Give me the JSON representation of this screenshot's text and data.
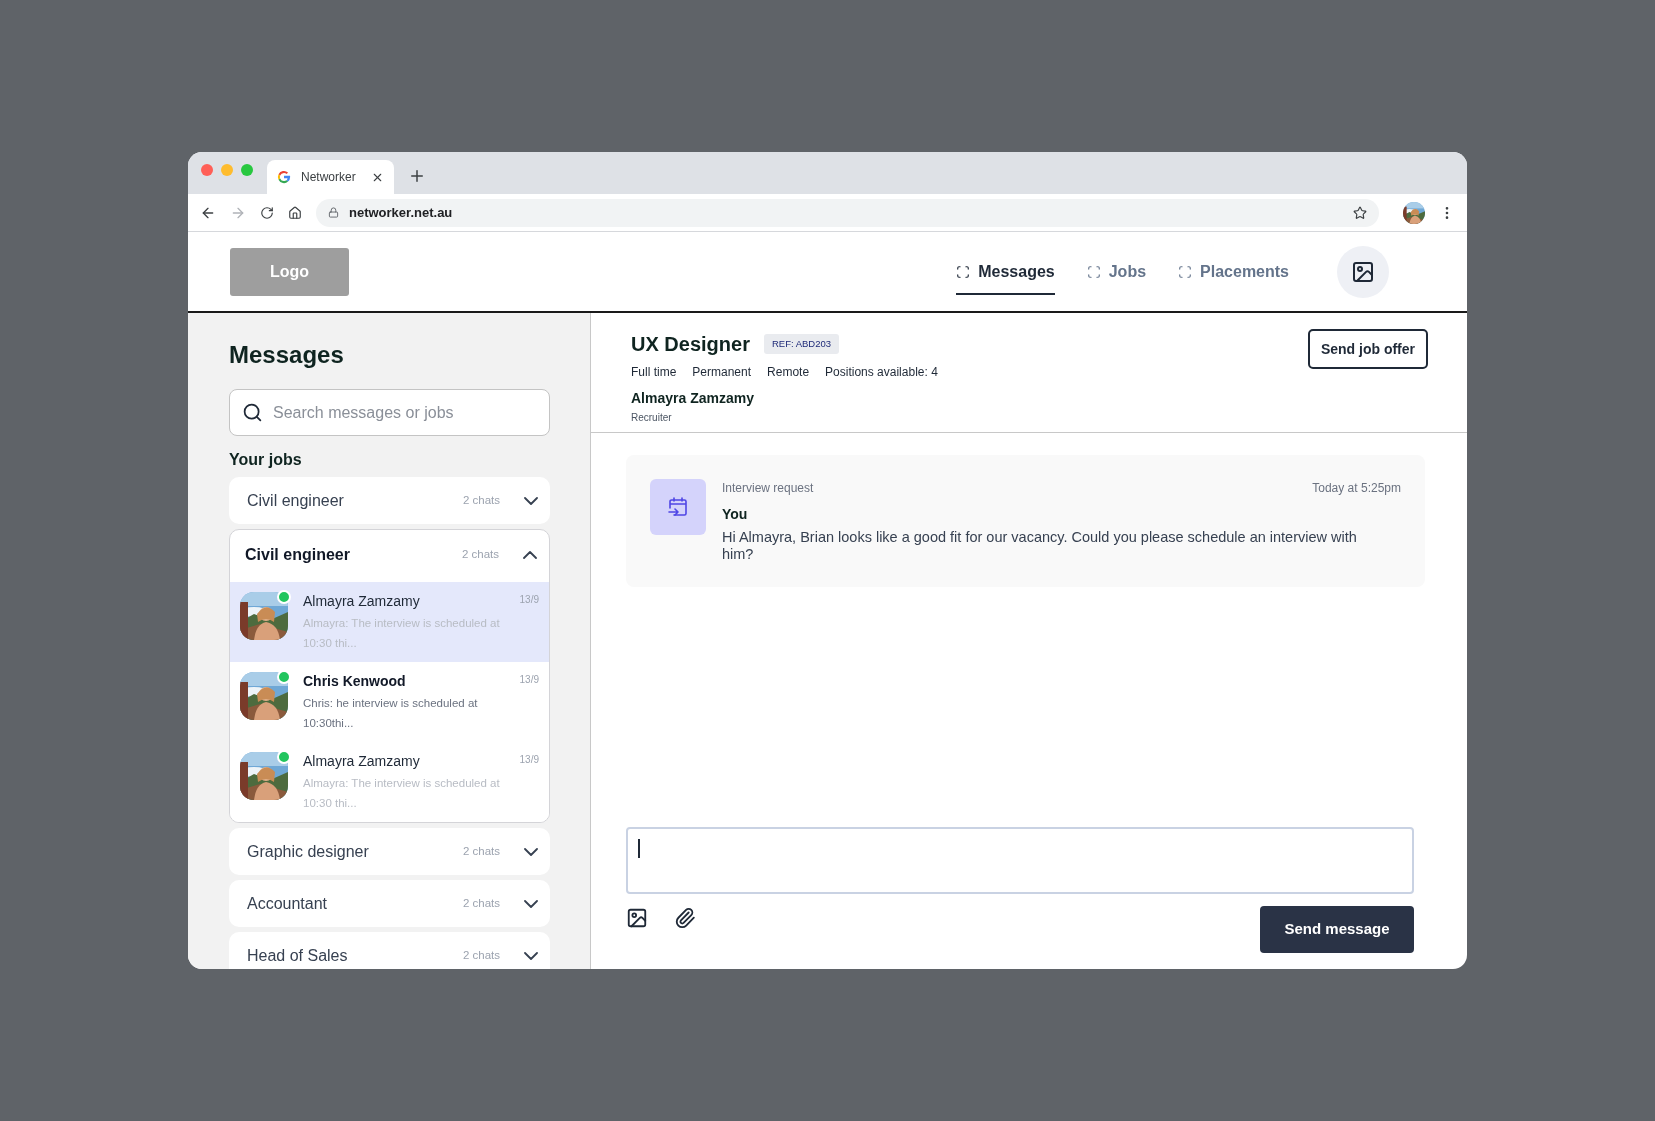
{
  "browser": {
    "tab_title": "Networker",
    "url": "networker.net.au"
  },
  "header": {
    "logo": "Logo",
    "nav": [
      {
        "label": "Messages",
        "selected": true
      },
      {
        "label": "Jobs",
        "selected": false
      },
      {
        "label": "Placements",
        "selected": false
      }
    ]
  },
  "sidebar": {
    "title": "Messages",
    "search": {
      "placeholder": "Search messages or jobs"
    },
    "section_label": "Your jobs",
    "jobs": [
      {
        "title": "Civil engineer",
        "chats": "2 chats",
        "expanded": false
      },
      {
        "title": "Civil engineer",
        "chats": "2 chats",
        "expanded": true,
        "conversations": [
          {
            "name": "Almayra Zamzamy",
            "time": "13/9",
            "preview": "Almayra: The interview is scheduled at 10:30 thi...",
            "unread": false,
            "selected": true,
            "online": true
          },
          {
            "name": "Chris Kenwood",
            "time": "13/9",
            "preview": "Chris: he interview is scheduled at 10:30thi...",
            "unread": true,
            "selected": false,
            "online": true
          },
          {
            "name": "Almayra Zamzamy",
            "time": "13/9",
            "preview": "Almayra: The interview is scheduled at 10:30 thi...",
            "unread": false,
            "selected": false,
            "online": true
          }
        ]
      },
      {
        "title": "Graphic designer",
        "chats": "2 chats",
        "expanded": false
      },
      {
        "title": "Accountant",
        "chats": "2 chats",
        "expanded": false
      },
      {
        "title": "Head of Sales",
        "chats": "2 chats",
        "expanded": false
      }
    ]
  },
  "job": {
    "title": "UX Designer",
    "ref": "REF: ABD203",
    "tags": [
      "Full time",
      "Permanent",
      "Remote",
      "Positions available: 4"
    ],
    "contact_name": "Almayra Zamzamy",
    "contact_role": "Recruiter",
    "action": "Send job offer"
  },
  "messages": [
    {
      "type": "Interview request",
      "time": "Today at 5:25pm",
      "sender": "You",
      "text": "Hi Almayra, Brian looks like a good fit for our vacancy. Could you please schedule an interview with him?"
    }
  ],
  "composer": {
    "send": "Send message"
  }
}
